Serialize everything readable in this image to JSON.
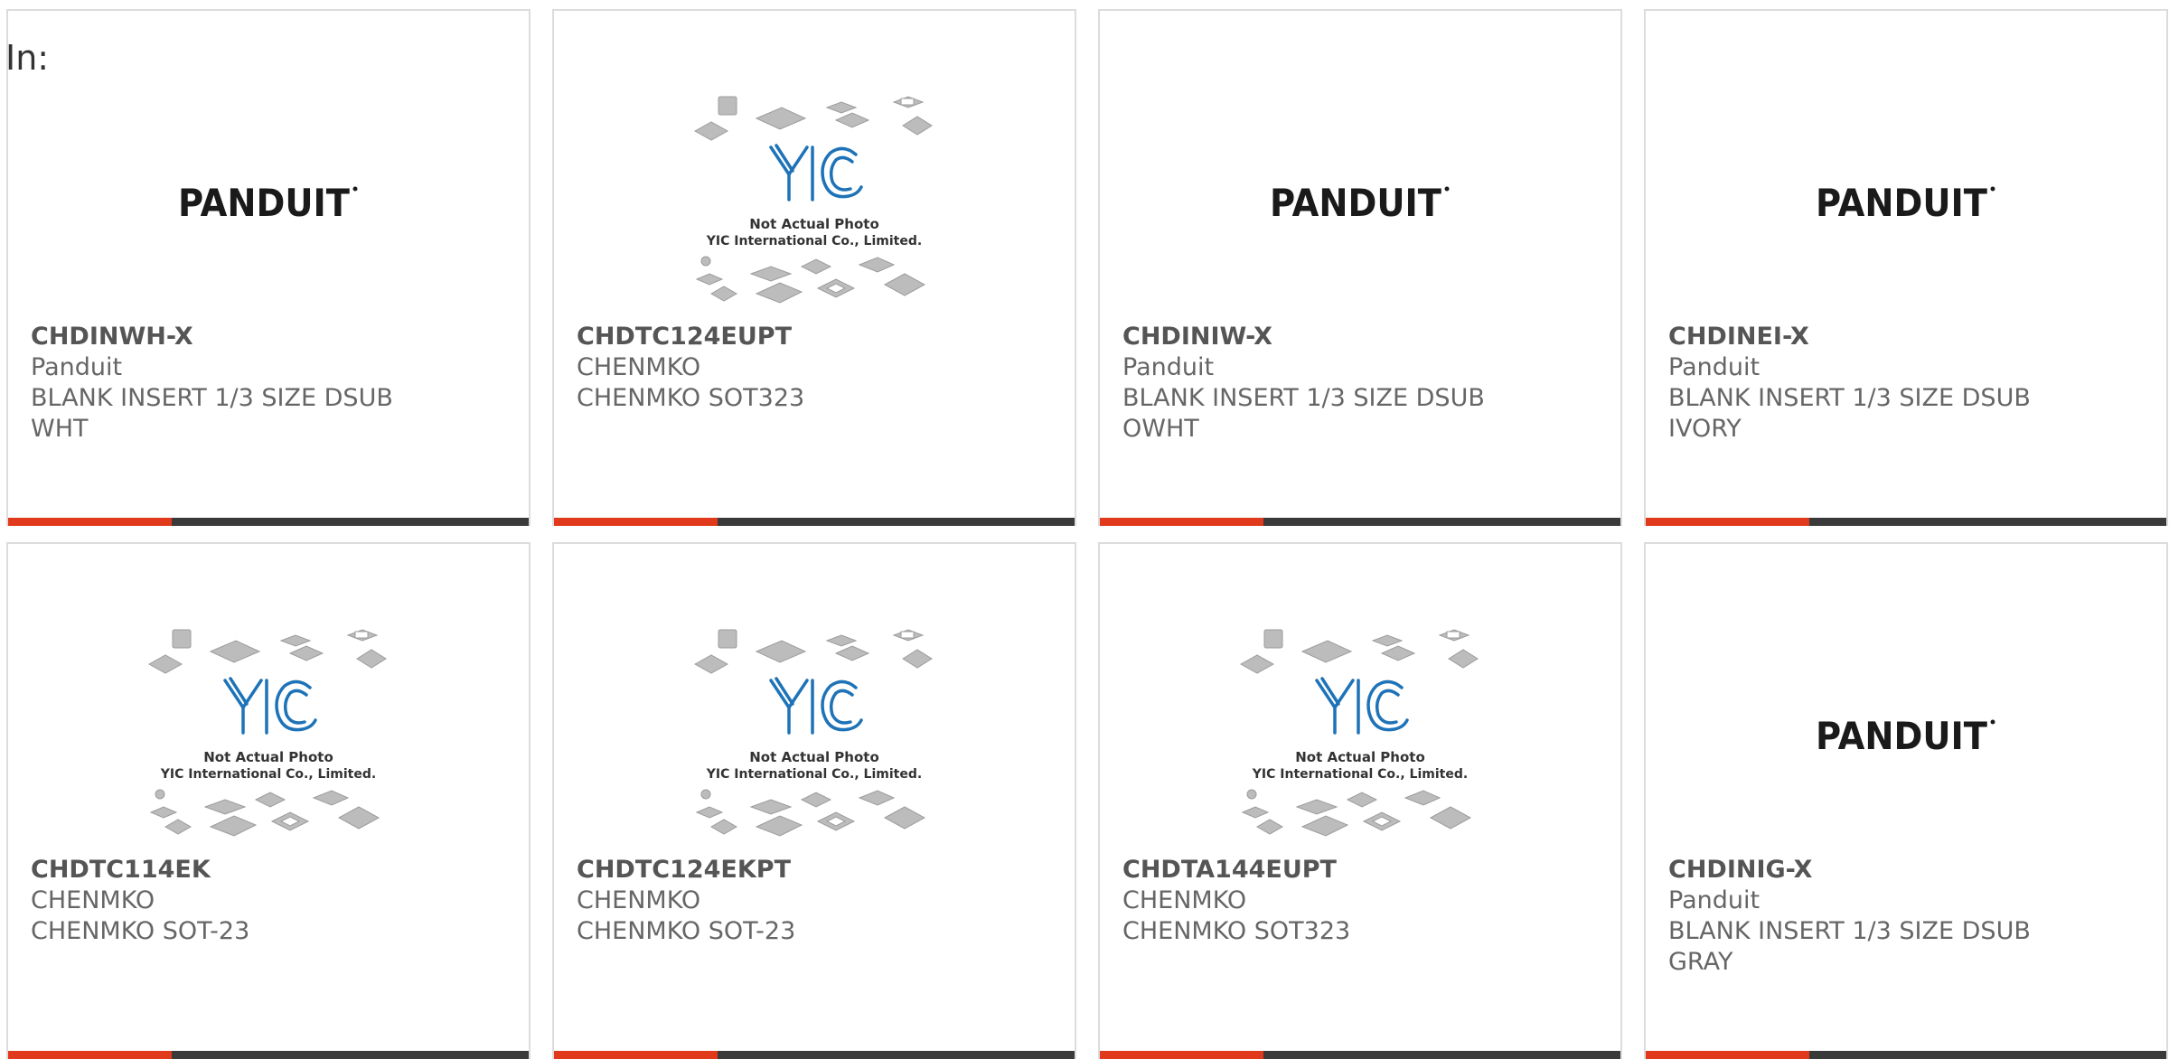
{
  "filter_label": "In:",
  "products": [
    {
      "part": "CHDINWH-X",
      "maker": "Panduit",
      "desc": "BLANK INSERT 1/3 SIZE DSUB\nWHT",
      "image": "panduit-logo"
    },
    {
      "part": "CHDTC124EUPT",
      "maker": "CHENMKO",
      "desc": "CHENMKO SOT323",
      "image": "yic-not-actual-photo"
    },
    {
      "part": "CHDINIW-X",
      "maker": "Panduit",
      "desc": "BLANK INSERT 1/3 SIZE DSUB\nOWHT",
      "image": "panduit-logo"
    },
    {
      "part": "CHDINEI-X",
      "maker": "Panduit",
      "desc": "BLANK INSERT 1/3 SIZE DSUB\nIVORY",
      "image": "panduit-logo"
    },
    {
      "part": "CHDTC114EK",
      "maker": "CHENMKO",
      "desc": "CHENMKO SOT-23",
      "image": "yic-not-actual-photo"
    },
    {
      "part": "CHDTC124EKPT",
      "maker": "CHENMKO",
      "desc": "CHENMKO SOT-23",
      "image": "yic-not-actual-photo"
    },
    {
      "part": "CHDTA144EUPT",
      "maker": "CHENMKO",
      "desc": "CHENMKO SOT323",
      "image": "yic-not-actual-photo"
    },
    {
      "part": "CHDINIG-X",
      "maker": "Panduit",
      "desc": "BLANK INSERT 1/3 SIZE DSUB\nGRAY",
      "image": "panduit-logo"
    }
  ],
  "placeholder_image": {
    "caption_line1": "Not Actual Photo",
    "caption_line2": "YIC International Co., Limited."
  },
  "colors": {
    "accent": "#e1391b",
    "bar": "#3a3a3a",
    "border": "#dcdcdc",
    "yic_blue": "#1e73b8"
  }
}
